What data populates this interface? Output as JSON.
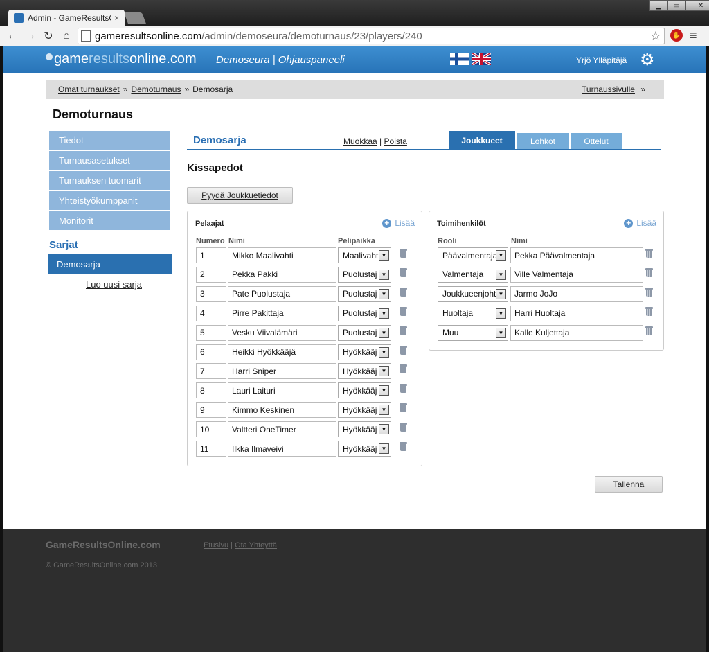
{
  "browser": {
    "tab_title": "Admin - GameResultsOnli",
    "tab_close": "×",
    "url_host": "gameresultsonline.com",
    "url_path": "/admin/demoseura/demoturnaus/23/players/240",
    "win_min": "▁",
    "win_max": "▭",
    "win_close": "✕",
    "back": "←",
    "forward": "→",
    "reload": "↻",
    "home": "⌂",
    "star": "☆",
    "menu": "≡"
  },
  "header": {
    "logo_light": "game",
    "logo_accent": "results",
    "logo_rest": "online.com",
    "org_title": "Demoseura | Ohjauspaneeli",
    "user_name": "Yrjö Ylläpitäjä",
    "gear": "⚙"
  },
  "breadcrumb": {
    "items": [
      "Omat turnaukset",
      "Demoturnaus"
    ],
    "current": "Demosarja",
    "sep": "»",
    "right_link": "Turnaussivulle",
    "right_sep": "»"
  },
  "page_title": "Demoturnaus",
  "sidebar": {
    "items": [
      "Tiedot",
      "Turnausasetukset",
      "Turnauksen tuomarit",
      "Yhteistyökumppanit",
      "Monitorit"
    ],
    "series_title": "Sarjat",
    "series_item": "Demosarja",
    "new_series": "Luo uusi sarja"
  },
  "main": {
    "series_title": "Demosarja",
    "edit": "Muokkaa",
    "link_sep": "|",
    "delete": "Poista",
    "tabs": [
      "Joukkueet",
      "Lohkot",
      "Ottelut"
    ],
    "team_name": "Kissapedot",
    "request_button": "Pyydä Joukkuetiedot",
    "save_button": "Tallenna"
  },
  "players": {
    "title": "Pelaajat",
    "add": "Lisää",
    "plus": "+",
    "col_number": "Numero",
    "col_name": "Nimi",
    "col_position": "Pelipaikka",
    "rows": [
      {
        "number": "1",
        "name": "Mikko Maalivahti",
        "position": "Maalivaht"
      },
      {
        "number": "2",
        "name": "Pekka Pakki",
        "position": "Puolustaj"
      },
      {
        "number": "3",
        "name": "Pate Puolustaja",
        "position": "Puolustaj"
      },
      {
        "number": "4",
        "name": "Pirre Pakittaja",
        "position": "Puolustaj"
      },
      {
        "number": "5",
        "name": "Vesku Viivalämäri",
        "position": "Puolustaj"
      },
      {
        "number": "6",
        "name": "Heikki Hyökkääjä",
        "position": "Hyökkääj"
      },
      {
        "number": "7",
        "name": "Harri Sniper",
        "position": "Hyökkääj"
      },
      {
        "number": "8",
        "name": "Lauri Laituri",
        "position": "Hyökkääj"
      },
      {
        "number": "9",
        "name": "Kimmo Keskinen",
        "position": "Hyökkääj"
      },
      {
        "number": "10",
        "name": "Valtteri OneTimer",
        "position": "Hyökkääj"
      },
      {
        "number": "11",
        "name": "Ilkka Ilmaveivi",
        "position": "Hyökkääj"
      }
    ]
  },
  "staff": {
    "title": "Toimihenkilöt",
    "add": "Lisää",
    "plus": "+",
    "col_role": "Rooli",
    "col_name": "Nimi",
    "rows": [
      {
        "role": "Päävalmentaja",
        "name": "Pekka Päävalmentaja"
      },
      {
        "role": "Valmentaja",
        "name": "Ville Valmentaja"
      },
      {
        "role": "Joukkueenjohtaja",
        "name": "Jarmo JoJo"
      },
      {
        "role": "Huoltaja",
        "name": "Harri Huoltaja"
      },
      {
        "role": "Muu",
        "name": "Kalle Kuljettaja"
      }
    ]
  },
  "select_arrow": "▼",
  "footer": {
    "brand": "GameResultsOnline.com",
    "link_home": "Etusivu",
    "link_sep": "|",
    "link_contact": "Ota Yhteyttä",
    "copyright": "© GameResultsOnline.com 2013"
  },
  "colors": {
    "header_blue": "#2a74b8",
    "active_blue": "#2a70b0",
    "light_blue": "#8fb6dc",
    "footer_dark": "#2e2e2e"
  }
}
